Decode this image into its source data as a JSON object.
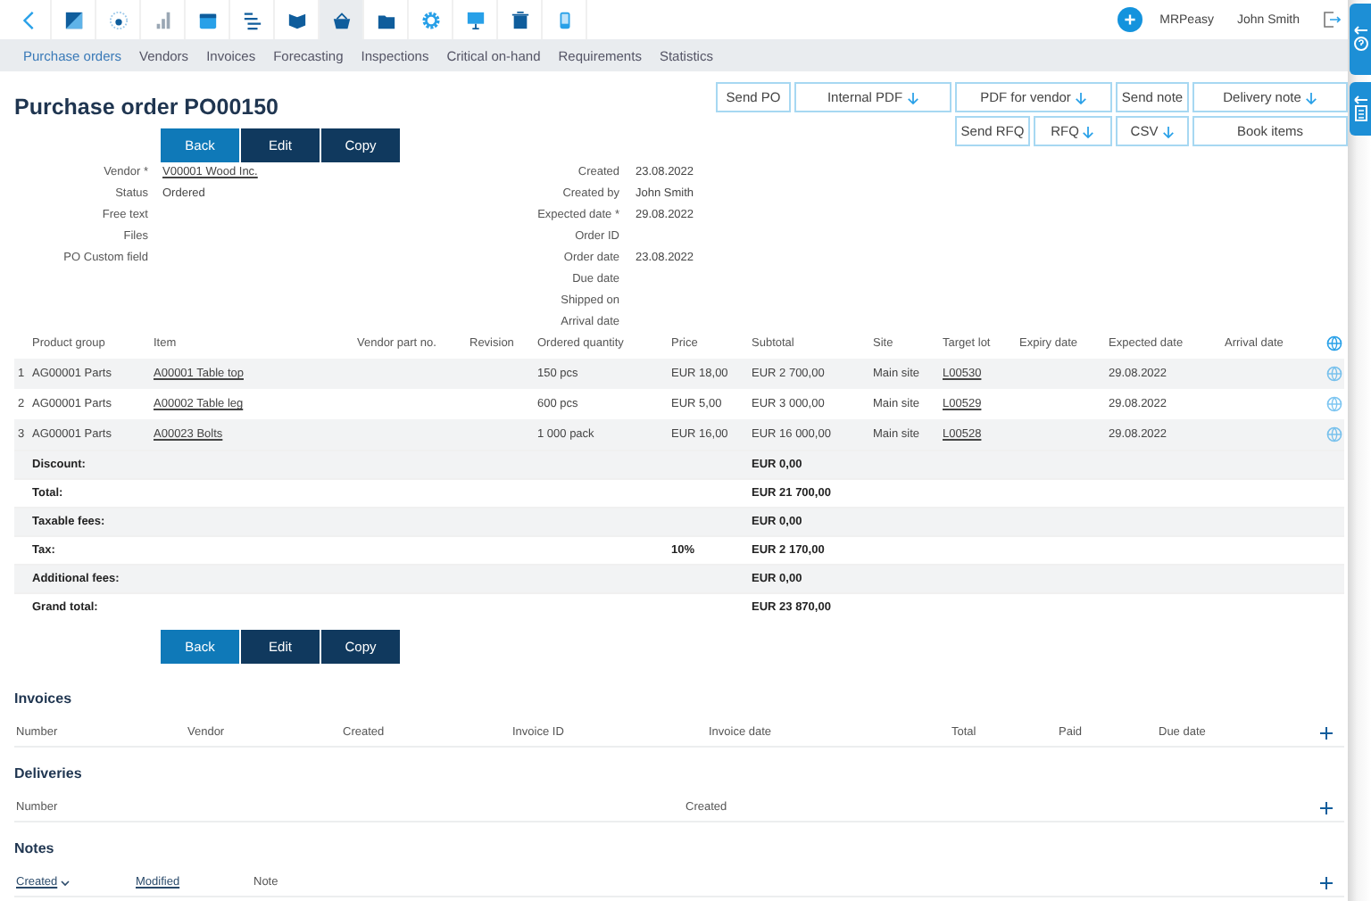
{
  "app_icons": [
    {
      "kind": "back",
      "selected": false
    },
    {
      "kind": "square",
      "selected": false
    },
    {
      "kind": "dial",
      "selected": false
    },
    {
      "kind": "bars",
      "selected": false
    },
    {
      "kind": "calendar",
      "selected": false
    },
    {
      "kind": "list",
      "selected": false
    },
    {
      "kind": "book",
      "selected": false
    },
    {
      "kind": "basket",
      "selected": true
    },
    {
      "kind": "folder",
      "selected": false
    },
    {
      "kind": "gear",
      "selected": false
    },
    {
      "kind": "monitor",
      "selected": false
    },
    {
      "kind": "bin",
      "selected": false
    },
    {
      "kind": "phone",
      "selected": false
    }
  ],
  "header": {
    "brand": "MRPeasy",
    "user": "John Smith"
  },
  "tabs": [
    {
      "label": "Purchase orders",
      "selected": true
    },
    {
      "label": "Vendors",
      "selected": false
    },
    {
      "label": "Invoices",
      "selected": false
    },
    {
      "label": "Forecasting",
      "selected": false
    },
    {
      "label": "Inspections",
      "selected": false
    },
    {
      "label": "Critical on-hand",
      "selected": false
    },
    {
      "label": "Requirements",
      "selected": false
    },
    {
      "label": "Statistics",
      "selected": false
    }
  ],
  "title": "Purchase order PO00150",
  "actions": [
    {
      "label": "Back",
      "kind": "primary"
    },
    {
      "label": "Edit",
      "kind": "secondary"
    },
    {
      "label": "Copy",
      "kind": "secondary"
    }
  ],
  "document_buttons": [
    [
      {
        "label": "Send PO",
        "download": false
      },
      {
        "label": "Internal PDF",
        "download": true
      },
      {
        "label": "PDF for vendor",
        "download": true
      },
      {
        "label": "Send note",
        "download": false
      },
      {
        "label": "Delivery note",
        "download": true
      }
    ],
    [
      {
        "label": "Send RFQ",
        "download": false
      },
      {
        "label": "RFQ",
        "download": true
      },
      {
        "label": "CSV",
        "download": true
      },
      {
        "label": "Book items",
        "download": false
      }
    ]
  ],
  "fields_left": [
    {
      "label": "Vendor *",
      "value": "V00001 Wood Inc.",
      "link": true
    },
    {
      "label": "Status",
      "value": "Ordered",
      "link": false
    },
    {
      "label": "Free text"
    },
    {
      "label": "Files"
    },
    {
      "label": "PO Custom field"
    }
  ],
  "fields_right": [
    {
      "label": "Created",
      "value": "23.08.2022"
    },
    {
      "label": "Created by",
      "value": "John Smith"
    },
    {
      "label": "Expected date *",
      "value": "29.08.2022"
    },
    {
      "label": "Order ID"
    },
    {
      "label": "Order date",
      "value": "23.08.2022"
    },
    {
      "label": "Due date"
    },
    {
      "label": "Shipped on"
    },
    {
      "label": "Arrival date"
    }
  ],
  "table": {
    "columns": [
      "Product group",
      "Item",
      "Vendor part no.",
      "Revision",
      "Ordered quantity",
      "Price",
      "Subtotal",
      "Site",
      "Target lot",
      "Expiry date",
      "Expected date",
      "Arrival date"
    ],
    "rows": [
      {
        "number": "1",
        "product_group": "AG00001 Parts",
        "item": "A00001 Table top",
        "ordered_quantity": "150 pcs",
        "price": "EUR 18,00",
        "subtotal": "EUR 2 700,00",
        "site": "Main site",
        "target_lot": "L00530",
        "expected_date": "29.08.2022"
      },
      {
        "number": "2",
        "product_group": "AG00001 Parts",
        "item": "A00002 Table leg",
        "ordered_quantity": "600 pcs",
        "price": "EUR 5,00",
        "subtotal": "EUR 3 000,00",
        "site": "Main site",
        "target_lot": "L00529",
        "expected_date": "29.08.2022"
      },
      {
        "number": "3",
        "product_group": "AG00001 Parts",
        "item": "A00023 Bolts",
        "ordered_quantity": "1 000 pack",
        "price": "EUR 16,00",
        "subtotal": "EUR 16 000,00",
        "site": "Main site",
        "target_lot": "L00528",
        "expected_date": "29.08.2022"
      }
    ],
    "summary": [
      {
        "label": "Discount:",
        "value": "EUR 0,00"
      },
      {
        "label": "Total:",
        "value": "EUR 21 700,00"
      },
      {
        "label": "Taxable fees:",
        "value": "EUR 0,00"
      },
      {
        "label": "Tax:",
        "rate": "10%",
        "value": "EUR 2 170,00"
      },
      {
        "label": "Additional fees:",
        "value": "EUR 0,00"
      },
      {
        "label": "Grand total:",
        "value": "EUR 23 870,00"
      }
    ]
  },
  "bottom_actions": [
    {
      "label": "Back",
      "kind": "primary"
    },
    {
      "label": "Edit",
      "kind": "secondary"
    },
    {
      "label": "Copy",
      "kind": "secondary"
    }
  ],
  "sections": [
    {
      "kind": "invoices",
      "title": "Invoices",
      "columns": [
        {
          "label": "Number",
          "sortable": false
        },
        {
          "label": "Vendor",
          "sortable": false
        },
        {
          "label": "Created",
          "sortable": false
        },
        {
          "label": "Invoice ID",
          "sortable": false
        },
        {
          "label": "Invoice date",
          "sortable": false
        },
        {
          "label": "Total",
          "sortable": false
        },
        {
          "label": "Paid",
          "sortable": false
        },
        {
          "label": "Due date",
          "sortable": false
        }
      ]
    },
    {
      "kind": "deliveries",
      "title": "Deliveries",
      "columns": [
        {
          "label": "Number",
          "sortable": false
        },
        {
          "label": "Created",
          "sortable": false
        }
      ]
    },
    {
      "kind": "notes",
      "title": "Notes",
      "columns": [
        {
          "label": "Created",
          "sortable": true,
          "sorted": true
        },
        {
          "label": "Modified",
          "sortable": true,
          "sorted": false
        },
        {
          "label": "Note",
          "sortable": false
        }
      ]
    }
  ]
}
